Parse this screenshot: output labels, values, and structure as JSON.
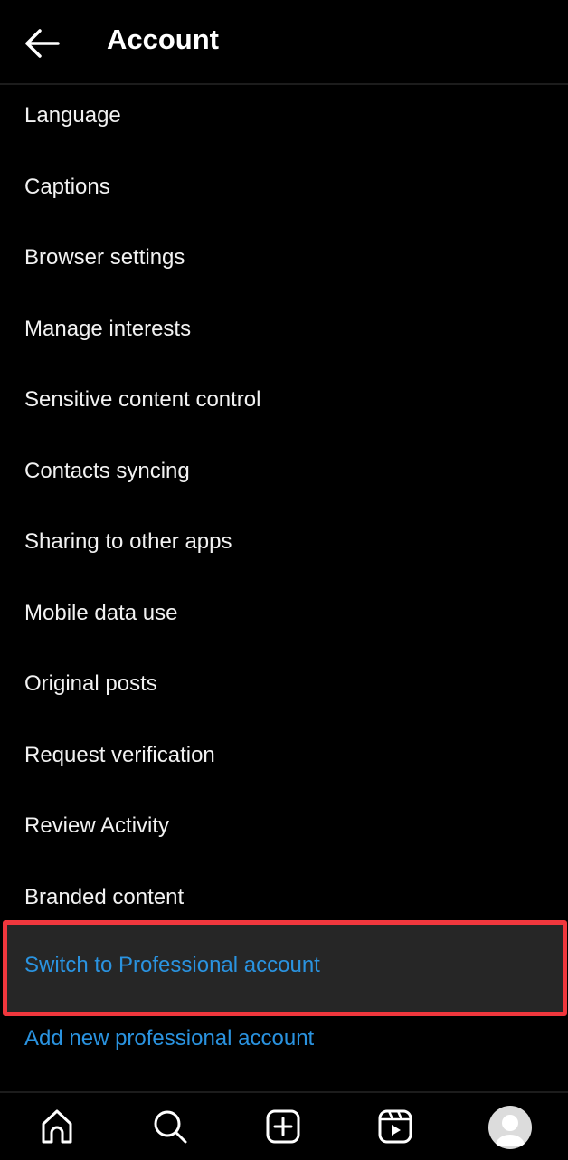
{
  "header": {
    "title": "Account",
    "back_icon": "arrow-left-icon"
  },
  "menu": {
    "items": [
      {
        "label": "Language"
      },
      {
        "label": "Captions"
      },
      {
        "label": "Browser settings"
      },
      {
        "label": "Manage interests"
      },
      {
        "label": "Sensitive content control"
      },
      {
        "label": "Contacts syncing"
      },
      {
        "label": "Sharing to other apps"
      },
      {
        "label": "Mobile data use"
      },
      {
        "label": "Original posts"
      },
      {
        "label": "Request verification"
      },
      {
        "label": "Review Activity"
      },
      {
        "label": "Branded content"
      }
    ],
    "switch_professional": "Switch to Professional account",
    "add_professional": "Add new professional account"
  },
  "colors": {
    "link": "#2a93e0",
    "highlight_border": "#f0373d"
  },
  "bottom_nav": {
    "items": [
      "home-icon",
      "search-icon",
      "create-icon",
      "reels-icon",
      "profile-avatar"
    ]
  }
}
